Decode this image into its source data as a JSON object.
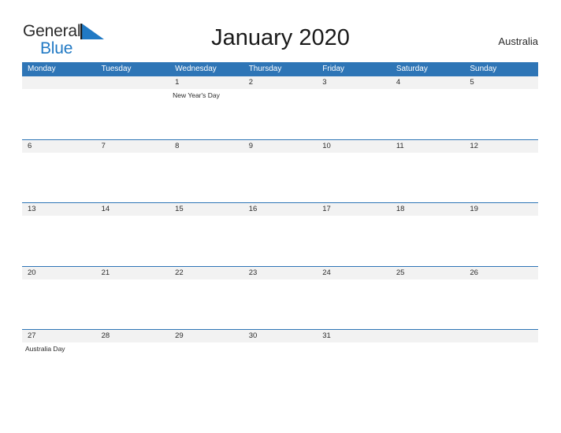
{
  "brand": {
    "name_part1": "General",
    "name_part2": "Blue",
    "flag_icon": "blue-triangle-flag-icon",
    "color_dark": "#2b2b2b",
    "color_blue": "#2079c4"
  },
  "header": {
    "title": "January 2020",
    "region": "Australia"
  },
  "theme": {
    "header_blue": "#2e75b6",
    "row_band_gray": "#f2f2f2",
    "text_dark": "#2b2b2b",
    "page_background": "#ffffff"
  },
  "calendar": {
    "month": "January",
    "year": "2020",
    "weekday_headers": [
      "Monday",
      "Tuesday",
      "Wednesday",
      "Thursday",
      "Friday",
      "Saturday",
      "Sunday"
    ],
    "weeks": [
      {
        "days": [
          {
            "num": "",
            "event": ""
          },
          {
            "num": "",
            "event": ""
          },
          {
            "num": "1",
            "event": "New Year's Day"
          },
          {
            "num": "2",
            "event": ""
          },
          {
            "num": "3",
            "event": ""
          },
          {
            "num": "4",
            "event": ""
          },
          {
            "num": "5",
            "event": ""
          }
        ]
      },
      {
        "days": [
          {
            "num": "6",
            "event": ""
          },
          {
            "num": "7",
            "event": ""
          },
          {
            "num": "8",
            "event": ""
          },
          {
            "num": "9",
            "event": ""
          },
          {
            "num": "10",
            "event": ""
          },
          {
            "num": "11",
            "event": ""
          },
          {
            "num": "12",
            "event": ""
          }
        ]
      },
      {
        "days": [
          {
            "num": "13",
            "event": ""
          },
          {
            "num": "14",
            "event": ""
          },
          {
            "num": "15",
            "event": ""
          },
          {
            "num": "16",
            "event": ""
          },
          {
            "num": "17",
            "event": ""
          },
          {
            "num": "18",
            "event": ""
          },
          {
            "num": "19",
            "event": ""
          }
        ]
      },
      {
        "days": [
          {
            "num": "20",
            "event": ""
          },
          {
            "num": "21",
            "event": ""
          },
          {
            "num": "22",
            "event": ""
          },
          {
            "num": "23",
            "event": ""
          },
          {
            "num": "24",
            "event": ""
          },
          {
            "num": "25",
            "event": ""
          },
          {
            "num": "26",
            "event": ""
          }
        ]
      },
      {
        "days": [
          {
            "num": "27",
            "event": "Australia Day"
          },
          {
            "num": "28",
            "event": ""
          },
          {
            "num": "29",
            "event": ""
          },
          {
            "num": "30",
            "event": ""
          },
          {
            "num": "31",
            "event": ""
          },
          {
            "num": "",
            "event": ""
          },
          {
            "num": "",
            "event": ""
          }
        ]
      }
    ]
  }
}
